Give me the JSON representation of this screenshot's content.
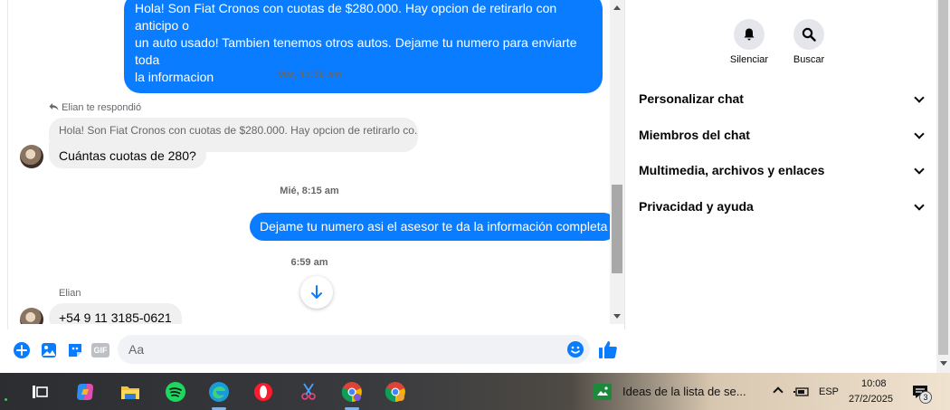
{
  "thread": {
    "top_message": {
      "line1": "Hola! Son Fiat Cronos con cuotas de $280.000. Hay opcion de retirarlo con anticipo o",
      "line2": "un auto usado! Tambien tenemos otros autos. Dejame tu numero para enviarte toda",
      "line3": "la informacion"
    },
    "stamp1": "Mar, 11:20 am",
    "reply_meta": "Elian te respondió",
    "quoted_reply": "Hola! Son Fiat Cronos con cuotas de $280.000. Hay opcion de retirarlo co...",
    "incoming1": "Cuántas cuotas de 280?",
    "stamp2": "Mié, 8:15 am",
    "outgoing2": "Dejame tu numero asi el asesor te da la información completa",
    "stamp3": "6:59 am",
    "sender_name": "Elian",
    "incoming2": "+54 9 11 3185-0621"
  },
  "composer": {
    "placeholder": "Aa",
    "gif_label": "GIF"
  },
  "panel": {
    "actions": [
      {
        "label": "Silenciar",
        "icon": "bell-icon"
      },
      {
        "label": "Buscar",
        "icon": "search-icon"
      }
    ],
    "sections": [
      "Personalizar chat",
      "Miembros del chat",
      "Multimedia, archivos y enlaces",
      "Privacidad y ayuda"
    ]
  },
  "taskbar": {
    "notification_text": "Ideas de la lista de se...",
    "language": "ESP",
    "time": "10:08",
    "date": "27/2/2025",
    "notif_count": "3"
  },
  "colors": {
    "accent": "#0a7cff",
    "incoming_bg": "#f0f0f0",
    "panel_text": "#050505"
  }
}
